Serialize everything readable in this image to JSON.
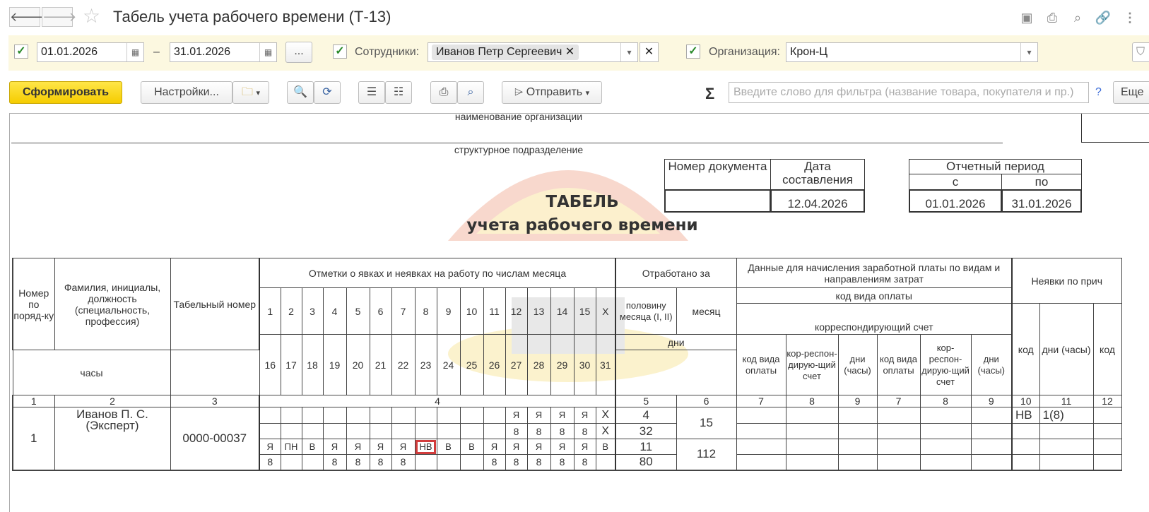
{
  "window": {
    "title": "Табель учета рабочего времени (Т-13)"
  },
  "filters": {
    "date_from": "01.01.2026",
    "dash": "–",
    "date_to": "31.01.2026",
    "more_label": "...",
    "employees_label": "Сотрудники:",
    "employee_chip": "Иванов Петр Сергеевич",
    "organization_label": "Организация:",
    "organization_value": "Крон-Ц"
  },
  "toolbar": {
    "generate_label": "Сформировать",
    "settings_label": "Настройки...",
    "send_label": "Отправить",
    "search_placeholder": "Введите слово для фильтра (название товара, покупателя и пр.)",
    "help_label": "?",
    "more_label": "Еще"
  },
  "report": {
    "org_caption": "наименование организации",
    "dept_caption": "структурное подразделение",
    "doc_number_header": "Номер документа",
    "doc_date_header": "Дата составления",
    "doc_number": "",
    "doc_date": "12.04.2026",
    "period_header": "Отчетный период",
    "period_from_header": "с",
    "period_to_header": "по",
    "period_from": "01.01.2026",
    "period_to": "31.01.2026",
    "title_line1": "ТАБЕЛЬ",
    "title_line2": "учета  рабочего времени"
  },
  "table": {
    "h_num": "Номер по поряд-ку",
    "h_name": "Фамилия, инициалы, должность (специальность, профессия)",
    "h_tab": "Табельный номер",
    "h_marks": "Отметки о явках и неявках на работу по числам месяца",
    "h_worked": "Отработано за",
    "h_half": "половину месяца (I, II)",
    "h_month": "месяц",
    "h_days": "дни",
    "h_hours": "часы",
    "h_pay": "Данные для начисления заработной платы по видам и направлениям затрат",
    "h_paycode": "код вида оплаты",
    "h_corr": "корреспондирующий счет",
    "h_c_code": "код вида оплаты",
    "h_c_corr": "кор-респон-дирую-щий счет",
    "h_c_days": "дни (часы)",
    "h_absence": "Неявки по прич",
    "h_a_code": "код",
    "h_a_days": "дни (часы)",
    "days_row1": [
      "1",
      "2",
      "3",
      "4",
      "5",
      "6",
      "7",
      "8",
      "9",
      "10",
      "11",
      "12",
      "13",
      "14",
      "15",
      "X"
    ],
    "days_row2": [
      "16",
      "17",
      "18",
      "19",
      "20",
      "21",
      "22",
      "23",
      "24",
      "25",
      "26",
      "27",
      "28",
      "29",
      "30",
      "31"
    ],
    "colnums": [
      "1",
      "2",
      "3",
      "4",
      "5",
      "6",
      "7",
      "8",
      "9",
      "7",
      "8",
      "9",
      "10",
      "11",
      "12"
    ],
    "employee": {
      "num": "1",
      "name": "Иванов П. С. (Эксперт)",
      "tab": "0000-00037",
      "r1": [
        "",
        "",
        "",
        "",
        "",
        "",
        "",
        "",
        "",
        "",
        "",
        "Я",
        "Я",
        "Я",
        "Я",
        "X"
      ],
      "r2": [
        "",
        "",
        "",
        "",
        "",
        "",
        "",
        "",
        "",
        "",
        "",
        "8",
        "8",
        "8",
        "8",
        "X"
      ],
      "r3": [
        "Я",
        "ПН",
        "В",
        "Я",
        "Я",
        "Я",
        "Я",
        "НВ",
        "В",
        "В",
        "Я",
        "Я",
        "Я",
        "Я",
        "Я",
        "В"
      ],
      "r4": [
        "8",
        "",
        "",
        "8",
        "8",
        "8",
        "8",
        "",
        "",
        "",
        "8",
        "8",
        "8",
        "8",
        "8",
        ""
      ],
      "half1_days": "4",
      "half1_hours": "32",
      "half2_days": "11",
      "half2_hours": "80",
      "month1": "15",
      "month2": "112",
      "abs_code": "НВ",
      "abs_days": "1(8)"
    }
  }
}
